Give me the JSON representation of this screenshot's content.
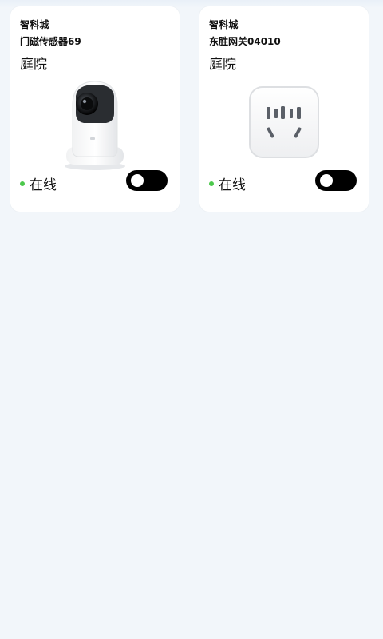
{
  "theme": {
    "online_color": "#4CC84C",
    "toggle_color": "#000000"
  },
  "devices": [
    {
      "community": "智科城",
      "name": "门磁传感器69",
      "room": "庭院",
      "status": "在线",
      "toggle_on": false,
      "icon": "camera-icon"
    },
    {
      "community": "智科城",
      "name": "东胜网关04010",
      "room": "庭院",
      "status": "在线",
      "toggle_on": false,
      "icon": "socket-icon"
    }
  ]
}
